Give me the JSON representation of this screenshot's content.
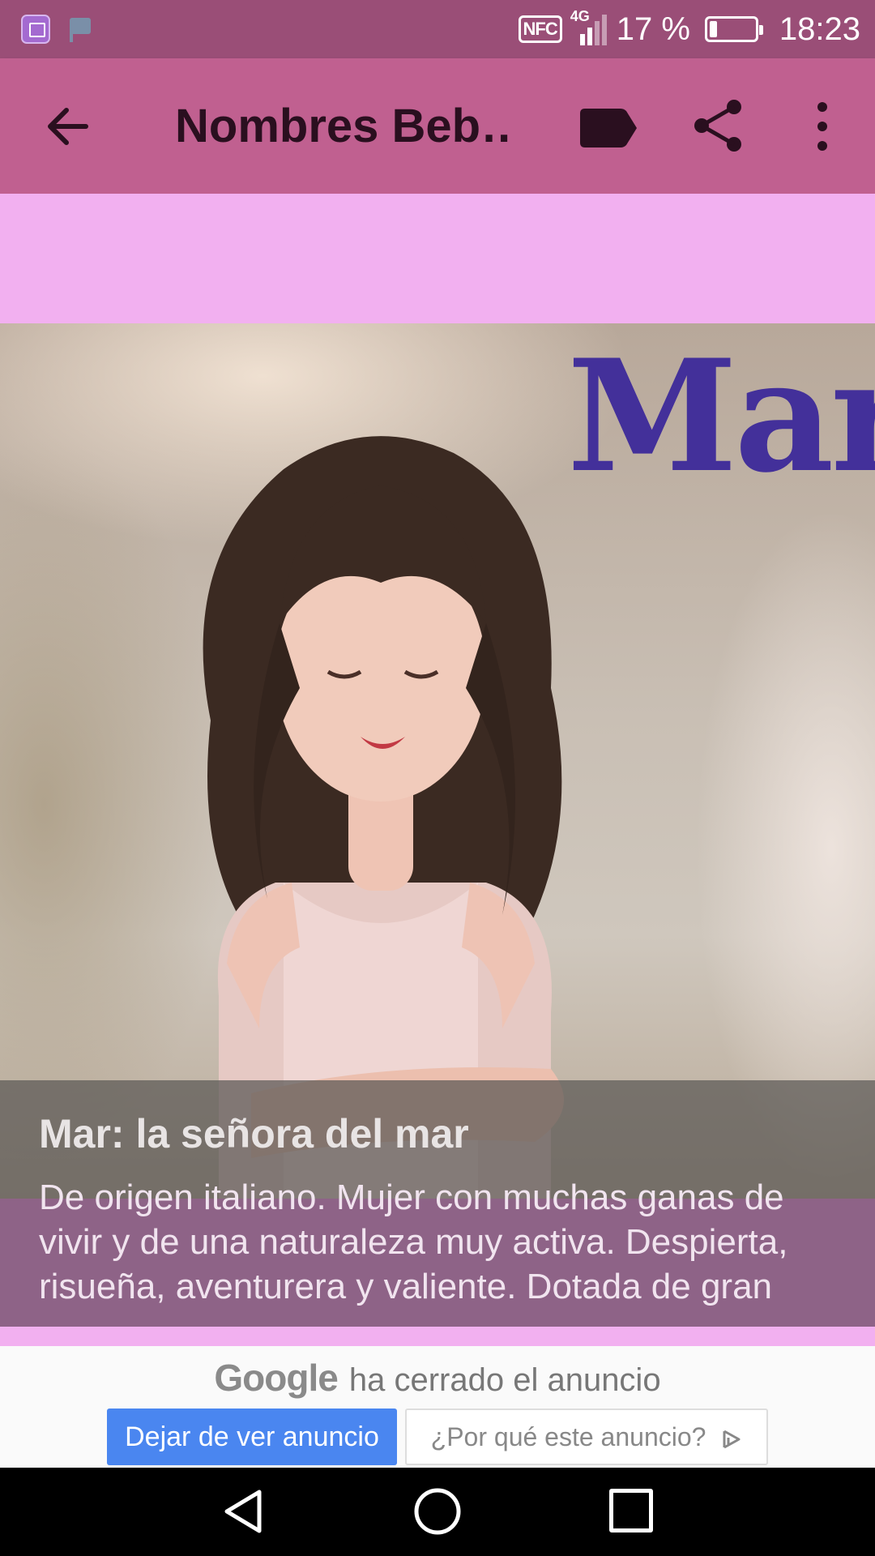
{
  "status_bar": {
    "battery_percent": "17 %",
    "time": "18:23",
    "network_type": "4G",
    "nfc_label": "NFC",
    "battery_level": 0.17
  },
  "app_bar": {
    "title": "Nombres Beb…",
    "icons": [
      "back-arrow-icon",
      "label-icon",
      "share-icon",
      "more-vert-icon"
    ]
  },
  "photo": {
    "overlay_name": "Mar"
  },
  "caption": {
    "title": "Mar: la señora del mar",
    "description": "De origen italiano. Mujer con muchas ganas de vivir y de una naturaleza muy activa. Despierta, risueña, aventurera y valiente. Dotada de gran"
  },
  "closed_ad": {
    "brand": "Google",
    "message": "ha cerrado el anuncio",
    "stop_button": "Dejar de ver anuncio",
    "why_button": "¿Por qué este anuncio?"
  },
  "colors": {
    "status_bar": "#9a4e77",
    "app_bar": "#c06090",
    "ad_strip": "#f2b0f0",
    "photo_name": "#43309a",
    "caption_desc_bg": "#8e6387",
    "stop_button": "#4a86f0"
  }
}
